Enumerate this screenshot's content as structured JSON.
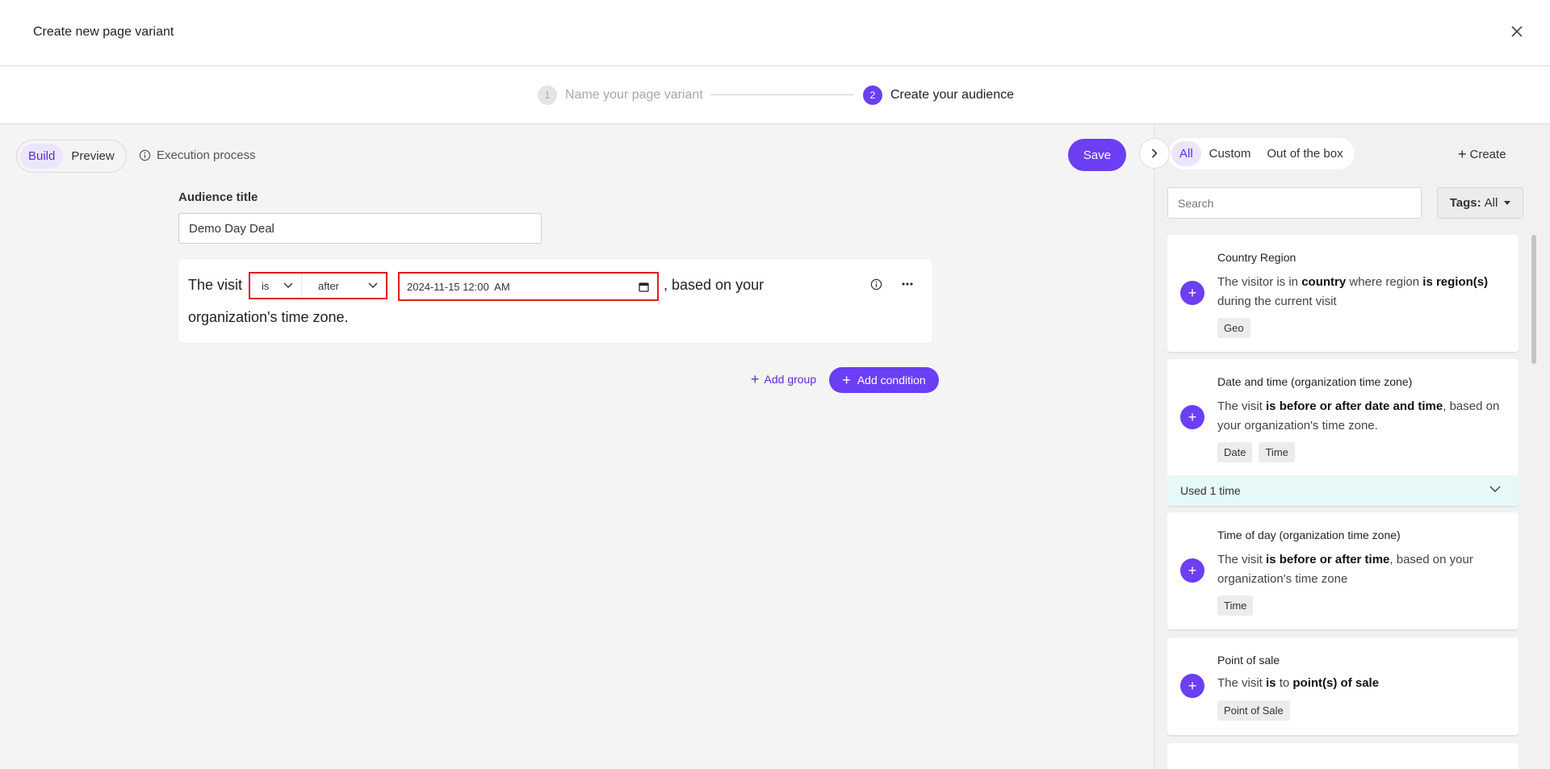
{
  "modal": {
    "title": "Create new page variant"
  },
  "stepper": {
    "steps": [
      {
        "num": "1",
        "label": "Name your page variant"
      },
      {
        "num": "2",
        "label": "Create your audience"
      }
    ]
  },
  "toolbar": {
    "tabs": [
      "Build",
      "Preview"
    ],
    "execution_label": "Execution process",
    "save_label": "Save"
  },
  "audience": {
    "title_label": "Audience title",
    "title_value": "Demo Day Deal"
  },
  "condition": {
    "prefix": "The visit",
    "operator": "is",
    "comparison": "after",
    "datetime": "2024-11-15 12:00  AM",
    "suffix_line1": ", based on your",
    "suffix_line2": "organization's time zone."
  },
  "actions": {
    "add_group": "Add group",
    "add_condition": "Add condition"
  },
  "panel": {
    "filters": [
      "All",
      "Custom",
      "Out of the box"
    ],
    "create_label": "Create",
    "search_placeholder": "Search",
    "tags_label": "Tags:",
    "tags_value": "All",
    "cards": [
      {
        "title": "Country Region",
        "desc": [
          "The visitor is in ",
          "country",
          " where region ",
          "is region(s)",
          " during the current visit"
        ],
        "tags": [
          "Geo"
        ]
      },
      {
        "title": "Date and time (organization time zone)",
        "desc": [
          "The visit ",
          "is before or after date and time",
          ", based on your organization's time zone."
        ],
        "tags": [
          "Date",
          "Time"
        ],
        "used": "Used 1 time"
      },
      {
        "title": "Time of day (organization time zone)",
        "desc": [
          "The visit ",
          "is before or after time",
          ", based on your organization's time zone"
        ],
        "tags": [
          "Time"
        ]
      },
      {
        "title": "Point of sale",
        "desc": [
          "The visit ",
          "is",
          " to ",
          "point(s) of sale"
        ],
        "tags": [
          "Point of Sale"
        ]
      }
    ]
  },
  "colors": {
    "accent": "#6c3ef4",
    "highlight_border": "#e01b1b",
    "used_bar": "#e6f8f7"
  }
}
